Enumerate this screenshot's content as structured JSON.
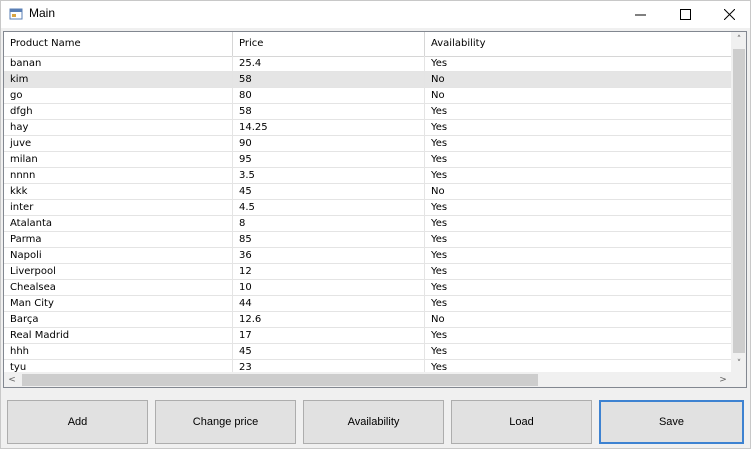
{
  "window": {
    "title": "Main"
  },
  "grid": {
    "columns": [
      "Product Name",
      "Price",
      "Availability"
    ],
    "rows": [
      [
        "banan",
        "25.4",
        "Yes"
      ],
      [
        "kim",
        "58",
        "No"
      ],
      [
        "go",
        "80",
        "No"
      ],
      [
        "dfgh",
        "58",
        "Yes"
      ],
      [
        "hay",
        "14.25",
        "Yes"
      ],
      [
        "juve",
        "90",
        "Yes"
      ],
      [
        "milan",
        "95",
        "Yes"
      ],
      [
        "nnnn",
        "3.5",
        "Yes"
      ],
      [
        "kkk",
        "45",
        "No"
      ],
      [
        "inter",
        "4.5",
        "Yes"
      ],
      [
        "Atalanta",
        "8",
        "Yes"
      ],
      [
        "Parma",
        "85",
        "Yes"
      ],
      [
        "Napoli",
        "36",
        "Yes"
      ],
      [
        "Liverpool",
        "12",
        "Yes"
      ],
      [
        "Chealsea",
        "10",
        "Yes"
      ],
      [
        "Man City",
        "44",
        "Yes"
      ],
      [
        "Barça",
        "12.6",
        "No"
      ],
      [
        "Real Madrid",
        "17",
        "Yes"
      ],
      [
        "hhh",
        "45",
        "Yes"
      ],
      [
        "tyu",
        "23",
        "Yes"
      ]
    ],
    "selected_row": 1
  },
  "buttons": {
    "add": "Add",
    "change_price": "Change price",
    "availability": "Availability",
    "load": "Load",
    "save": "Save"
  },
  "icons": {
    "app": "app-window-icon",
    "minimize": "minimize-icon",
    "maximize": "maximize-icon",
    "close": "close-icon"
  }
}
